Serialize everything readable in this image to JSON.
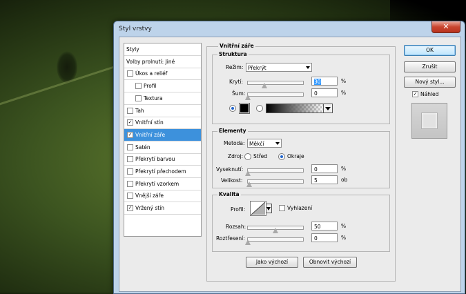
{
  "window": {
    "title": "Styl vrstvy",
    "close_glyph": "✕"
  },
  "sidebar": {
    "items": [
      {
        "label": "Styly",
        "checkbox": false,
        "checked": false,
        "selected": false
      },
      {
        "label": "Volby prolnutí: Jiné",
        "checkbox": false,
        "checked": false,
        "selected": false
      },
      {
        "label": "Úkos a reliéf",
        "checkbox": true,
        "checked": false,
        "selected": false
      },
      {
        "label": "Profil",
        "checkbox": true,
        "checked": false,
        "selected": false
      },
      {
        "label": "Textura",
        "checkbox": true,
        "checked": false,
        "selected": false
      },
      {
        "label": "Tah",
        "checkbox": true,
        "checked": false,
        "selected": false
      },
      {
        "label": "Vnitřní stín",
        "checkbox": true,
        "checked": true,
        "selected": false
      },
      {
        "label": "Vnitřní záře",
        "checkbox": true,
        "checked": true,
        "selected": true
      },
      {
        "label": "Satén",
        "checkbox": true,
        "checked": false,
        "selected": false
      },
      {
        "label": "Překrytí barvou",
        "checkbox": true,
        "checked": false,
        "selected": false
      },
      {
        "label": "Překrytí přechodem",
        "checkbox": true,
        "checked": false,
        "selected": false
      },
      {
        "label": "Překrytí vzorkem",
        "checkbox": true,
        "checked": false,
        "selected": false
      },
      {
        "label": "Vnější záře",
        "checkbox": true,
        "checked": false,
        "selected": false
      },
      {
        "label": "Vržený stín",
        "checkbox": true,
        "checked": true,
        "selected": false
      }
    ]
  },
  "panel": {
    "title": "Vnitřní záře",
    "structure": {
      "title": "Struktura",
      "mode_label": "Režim:",
      "mode_value": "Překrýt",
      "opacity_label": "Krytí:",
      "opacity_value": "30",
      "noise_label": "Šum:",
      "noise_value": "0",
      "percent": "%"
    },
    "elements": {
      "title": "Elementy",
      "method_label": "Metoda:",
      "method_value": "Měkčí",
      "source_label": "Zdroj:",
      "source_center": "Střed",
      "source_edge": "Okraje",
      "choke_label": "Vyseknutí:",
      "choke_value": "0",
      "size_label": "Velikost:",
      "size_value": "5",
      "percent": "%",
      "px_unit": "ob"
    },
    "quality": {
      "title": "Kvalita",
      "contour_label": "Profil:",
      "antialias_label": "Vyhlazení",
      "range_label": "Rozsah:",
      "range_value": "50",
      "jitter_label": "Roztřesení:",
      "jitter_value": "0",
      "percent": "%"
    },
    "make_default": "Jako výchozí",
    "reset_default": "Obnovit výchozí"
  },
  "buttons": {
    "ok": "OK",
    "cancel": "Zrušit",
    "new_style": "Nový styl...",
    "preview": "Náhled"
  },
  "colors": {
    "selection": "#3d91dc",
    "glow_color": "#000000"
  }
}
